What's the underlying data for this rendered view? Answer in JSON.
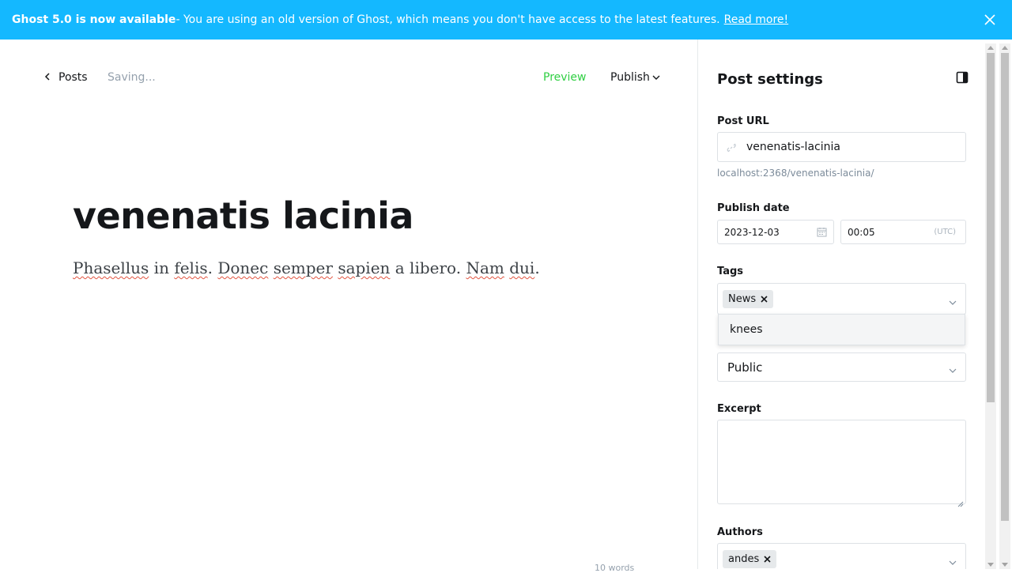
{
  "banner": {
    "title": "Ghost 5.0 is now available",
    "message": " - You are using an old version of Ghost, which means you don't have access to the latest features.",
    "link": "Read more!",
    "close_icon": "close-icon"
  },
  "editor": {
    "back_label": "Posts",
    "status": "Saving...",
    "preview_label": "Preview",
    "publish_label": "Publish",
    "post_title": "venenatis lacinia",
    "body_words": [
      "Phasellus",
      " in ",
      "felis",
      ". ",
      "Donec",
      " ",
      "semper",
      " ",
      "sapien",
      " a libero. ",
      "Nam",
      " ",
      "dui",
      "."
    ],
    "word_count": "10 words"
  },
  "settings": {
    "title": "Post settings",
    "post_url_label": "Post URL",
    "post_url_value": "venenatis-lacinia",
    "post_url_hint": "localhost:2368/venenatis-lacinia/",
    "publish_date_label": "Publish date",
    "publish_date": "2023-12-03",
    "publish_time": "00:05",
    "timezone": "(UTC)",
    "tags_label": "Tags",
    "tags": [
      "News"
    ],
    "tag_suggestion": "knees",
    "visibility_value": "Public",
    "excerpt_label": "Excerpt",
    "excerpt_value": "",
    "authors_label": "Authors",
    "authors": [
      "andes"
    ]
  },
  "colors": {
    "banner_bg": "#14b8ff",
    "preview_green": "#30cf43",
    "spell_underline": "#e25440"
  }
}
